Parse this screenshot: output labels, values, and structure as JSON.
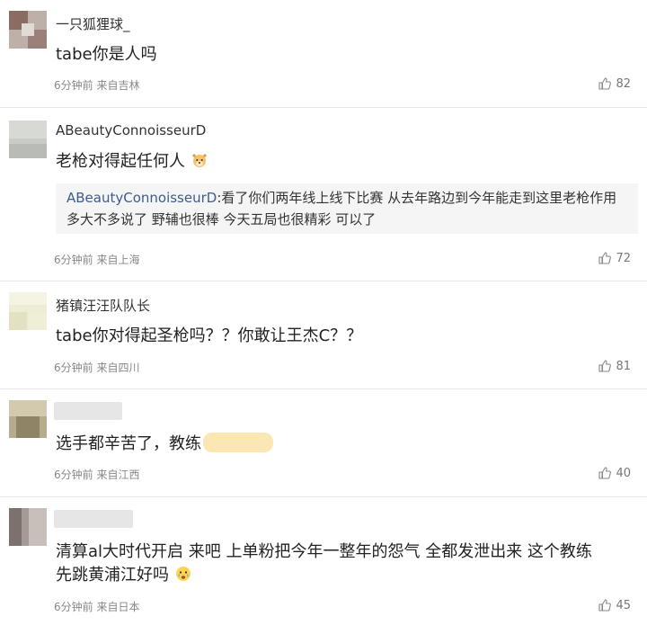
{
  "comments": [
    {
      "username": "一只狐狸球_",
      "text": "tabe你是人吗",
      "time": "6分钟前",
      "location": "来自吉林",
      "likes": "82"
    },
    {
      "username": "ABeautyConnoisseurD",
      "text": "老枪对得起任何人",
      "reply_name": "ABeautyConnoisseurD",
      "reply_text": ":看了你们两年线上线下比赛 从去年路边到今年能走到这里老枪作用多大不多说了 野辅也很棒 今天五局也很精彩 可以了",
      "time": "6分钟前",
      "location": "来自上海",
      "likes": "72"
    },
    {
      "username": "猪镇汪汪队队长",
      "text": "tabe你对得起圣枪吗？？你敢让王杰C？？",
      "time": "6分钟前",
      "location": "来自四川",
      "likes": "81"
    },
    {
      "username": "",
      "text": "选手都辛苦了，教练",
      "time": "6分钟前",
      "location": "来自江西",
      "likes": "40"
    },
    {
      "username": "",
      "text_line1": "清算al大时代开启 来吧 上单粉把今年一整年的怨气 全都发泄出来 这个教练",
      "text_line2": "先跳黄浦江好吗",
      "time": "6分钟前",
      "location": "来自日本",
      "likes": "45"
    }
  ],
  "icons": {
    "like": "thumbs-up-icon",
    "emoji_dog": "dog-face-emoji",
    "emoji_cry": "crying-face-emoji"
  }
}
